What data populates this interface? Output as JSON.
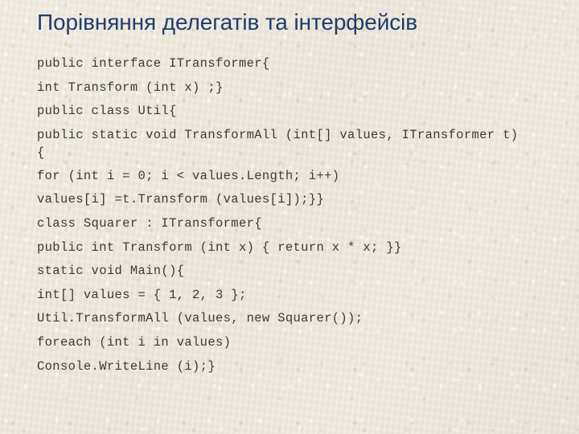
{
  "slide": {
    "title": "Порівняння делегатів та інтерфейсів",
    "background_color": "#ece7da",
    "title_color": "#1f3d6b",
    "code_color": "#3b3b39",
    "code": [
      "public interface ITransformer{",
      "int Transform (int x) ;}",
      "public class Util{",
      "public static void TransformAll (int[] values, ITransformer t){",
      "for (int i = 0; i < values.Length; i++)",
      "values[i] =t.Transform (values[i]);}}",
      "class Squarer : ITransformer{",
      "public int Transform (int x) { return x * x; }}",
      "static void Main(){",
      "int[] values = { 1, 2, 3 };",
      "Util.TransformAll (values, new Squarer());",
      "foreach (int i in values)",
      "Console.WriteLine (i);}"
    ]
  }
}
